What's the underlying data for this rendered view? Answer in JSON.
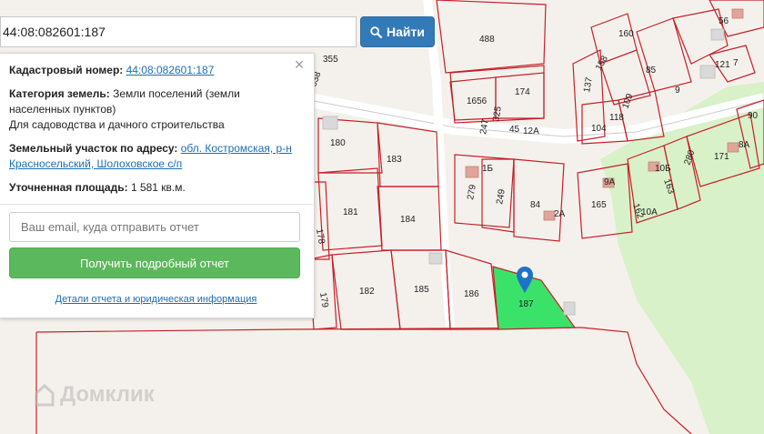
{
  "search": {
    "value": "44:08:082601:187",
    "button_label": "Найти",
    "button_icon": "search-icon"
  },
  "panel": {
    "cadastral_label": "Кадастровый номер:",
    "cadastral_value": "44:08:082601:187",
    "category_label": "Категория земель:",
    "category_value": "Земли поселений (земли населенных пунктов)",
    "usage": "Для садоводства и дачного строительства",
    "address_label": "Земельный участок по адресу:",
    "address_value": "обл. Костромская, р-н Красносельский, Шолоховское с/п",
    "area_label": "Уточненная площадь:",
    "area_value": "1 581 кв.м.",
    "email_placeholder": "Ваш email, куда отправить отчет",
    "report_button": "Получить подробный отчет",
    "details_link": "Детали отчета и юридическая информация",
    "close_icon": "close-icon"
  },
  "map": {
    "plots": [
      "488",
      "355",
      "638",
      "1656",
      "174",
      "247",
      "325",
      "45",
      "12А",
      "137",
      "160",
      "158",
      "85",
      "9",
      "56",
      "121",
      "7",
      "109",
      "118",
      "104",
      "180",
      "183",
      "279",
      "1Б",
      "249",
      "84",
      "2А",
      "9А",
      "165",
      "162",
      "10Б",
      "163",
      "280",
      "171",
      "8А",
      "90",
      "10А",
      "181",
      "184",
      "178",
      "179",
      "182",
      "185",
      "186",
      "187"
    ],
    "selected_color": "#3ae26a",
    "greenzone_color": "#d6f0c4",
    "boundary_color": "#c81e28"
  },
  "watermark": {
    "text": "Домклик"
  }
}
